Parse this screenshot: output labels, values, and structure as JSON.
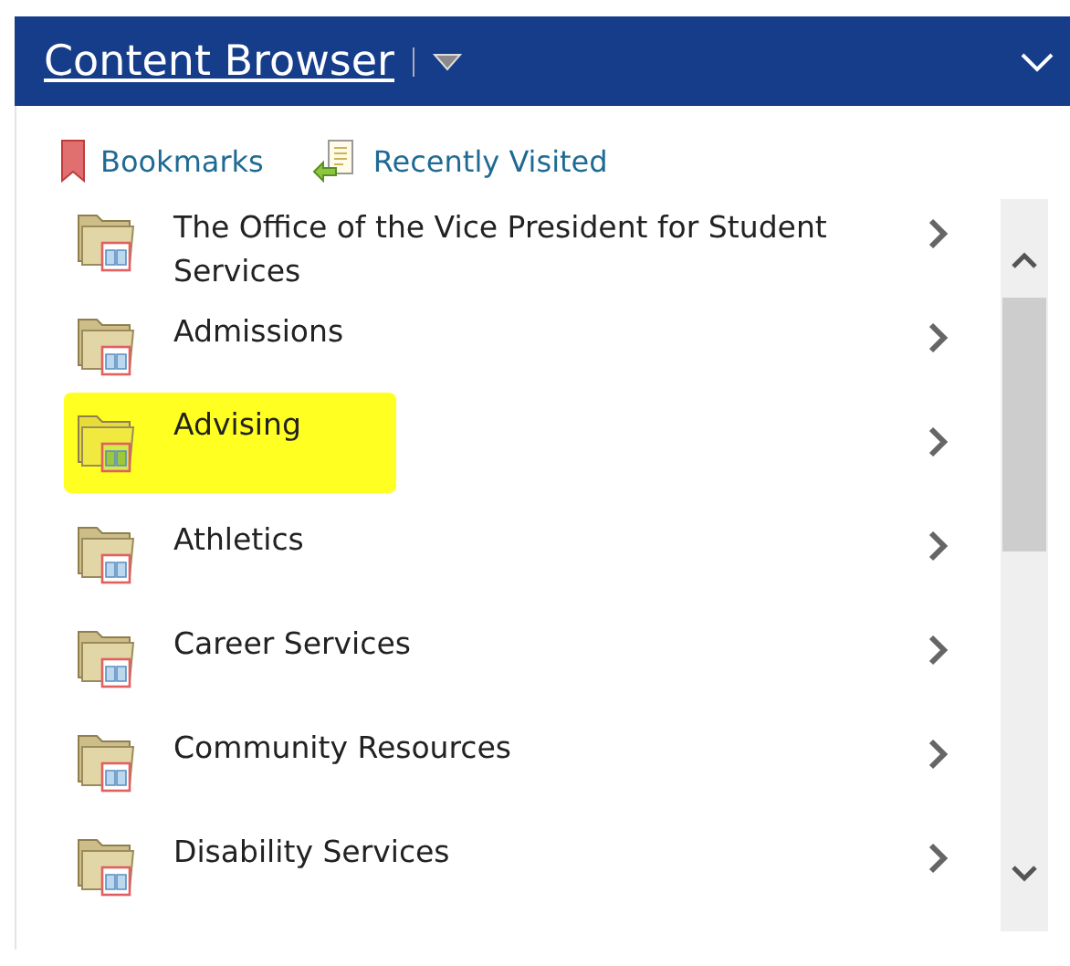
{
  "header": {
    "title": "Content Browser"
  },
  "toolbar": [
    {
      "kind": "bookmarks",
      "label": "Bookmarks"
    },
    {
      "kind": "recent",
      "label": "Recently Visited"
    }
  ],
  "items": [
    {
      "label": "The Office of the Vice President for Student Services",
      "highlighted": false
    },
    {
      "label": "Admissions",
      "highlighted": false
    },
    {
      "label": "Advising",
      "highlighted": true
    },
    {
      "label": "Athletics",
      "highlighted": false
    },
    {
      "label": "Career Services",
      "highlighted": false
    },
    {
      "label": "Community Resources",
      "highlighted": false
    },
    {
      "label": "Disability Services",
      "highlighted": false
    }
  ]
}
